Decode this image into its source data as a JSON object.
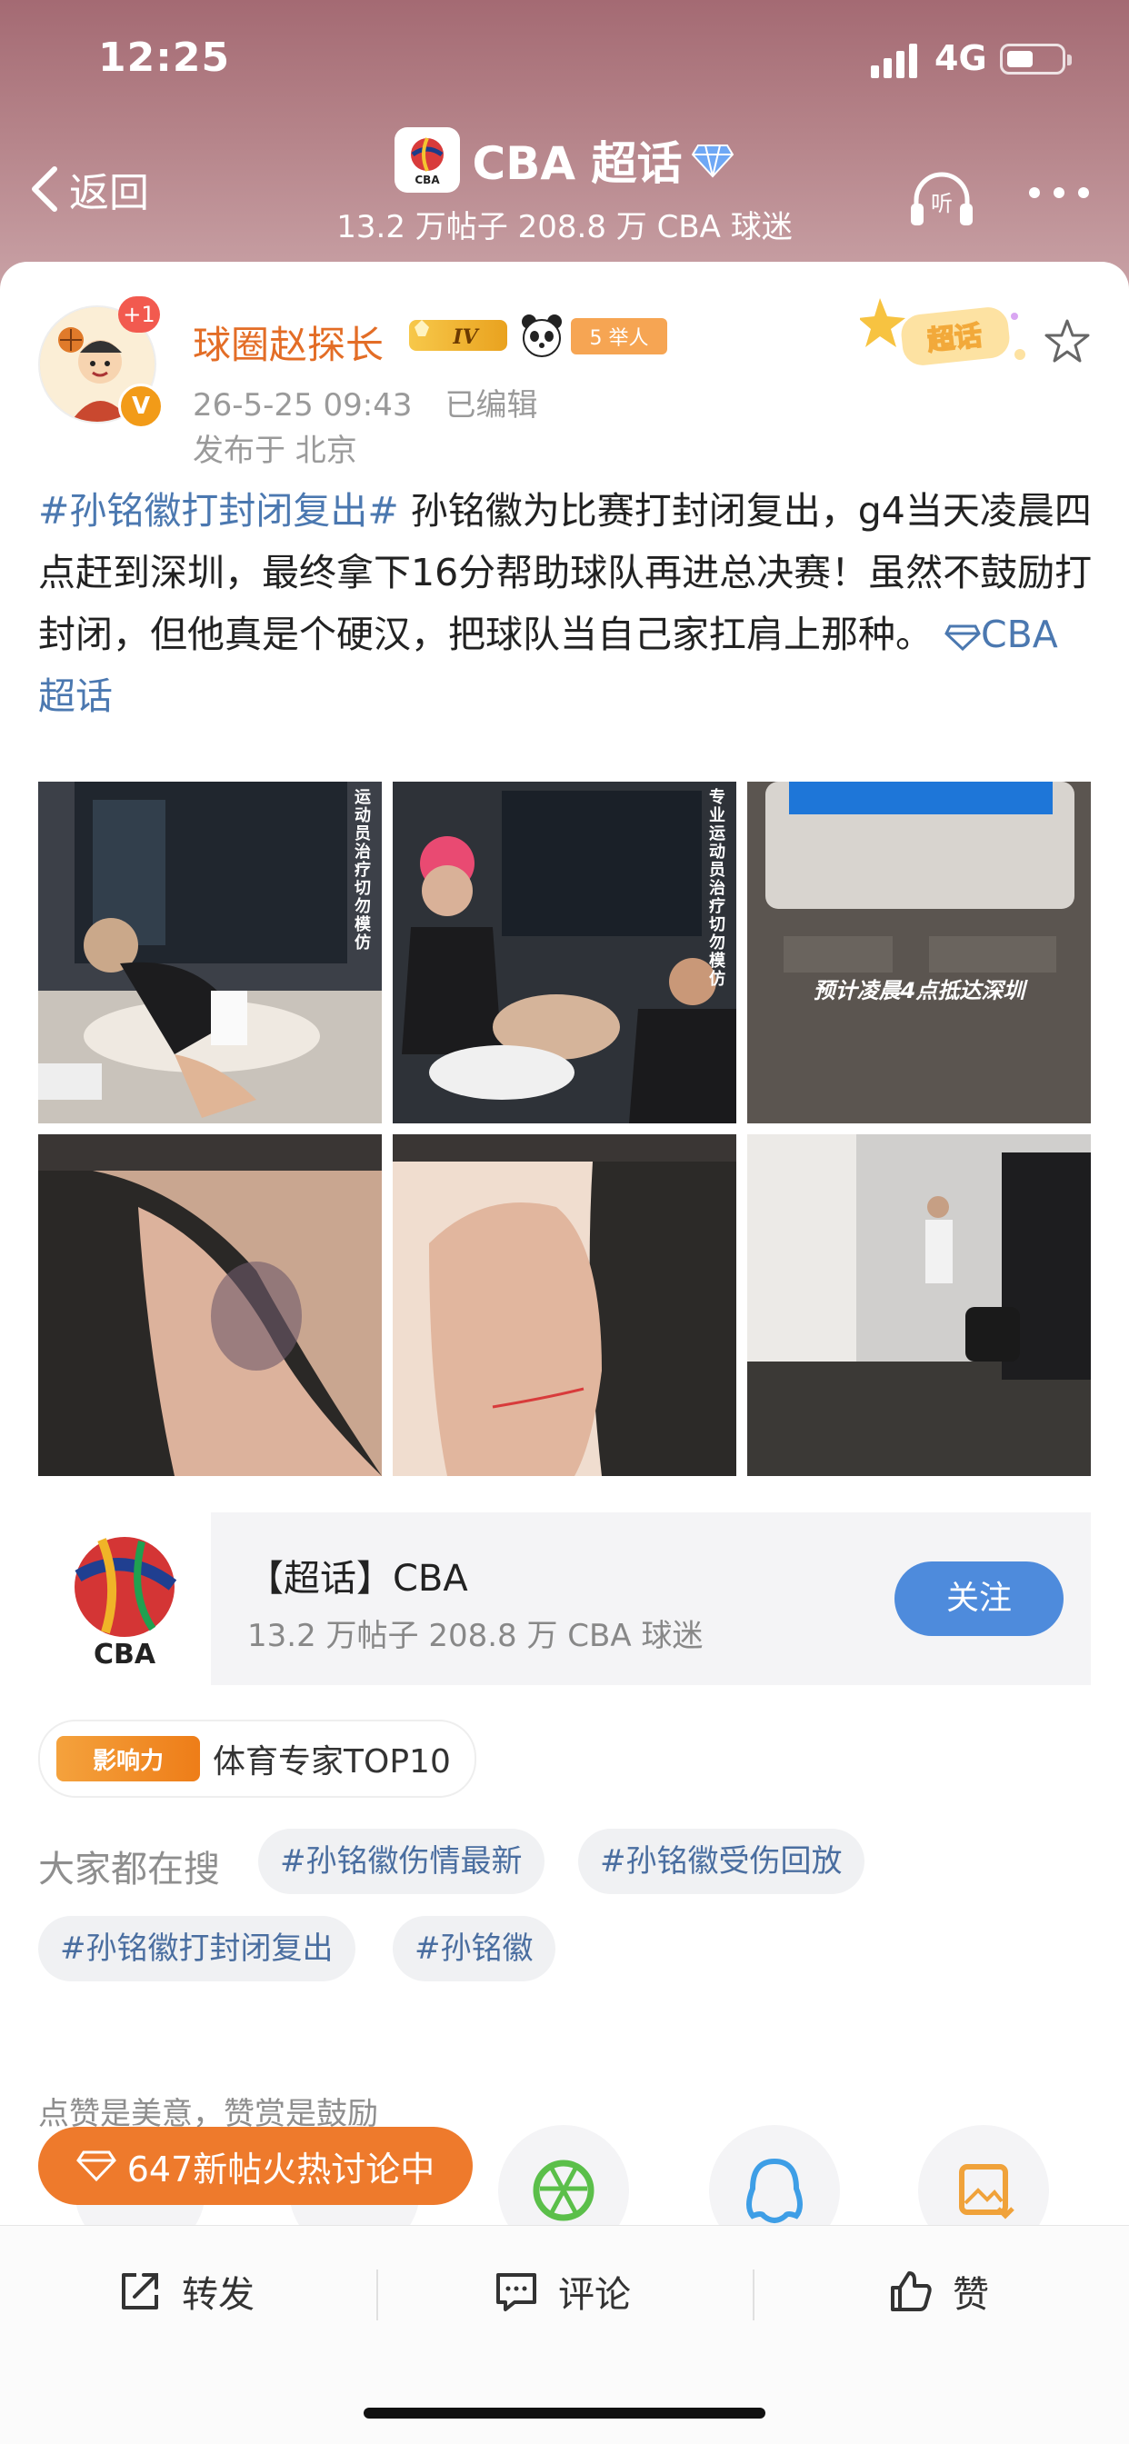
{
  "status_bar": {
    "time": "12:25",
    "network": "4G"
  },
  "nav": {
    "back_label": "返回",
    "title": "CBA 超话",
    "subtitle": "13.2 万帖子 208.8 万 CBA 球迷",
    "listen_label": "听",
    "logo_text": "CBA"
  },
  "post": {
    "username": "球圈赵探长",
    "plus_badge": "+1",
    "verified_badge": "V",
    "level_badge": "IV",
    "points_badge": "5 举人",
    "timestamp": "26-5-25 09:43",
    "edited": "已编辑",
    "location": "发布于 北京",
    "sticker_text": "超话",
    "text": {
      "hashtag": "#孙铭徽打封闭复出#",
      "body": " 孙铭徽为比赛打封闭复出，g4当天凌晨四点赶到深圳，最终拿下16分帮助球队再进总决赛！虽然不鼓励打封闭，但他真是个硬汉，把球队当自己家扛肩上那种。",
      "topic_link": "CBA 超话"
    },
    "photos": [
      {
        "overlay_vertical": "运动员治疗 切勿模仿"
      },
      {
        "overlay_vertical": "专业运动员治疗 切勿模仿"
      },
      {
        "overlay_caption": "预计凌晨4点抵达深圳"
      },
      {
        "overlay_caption": ""
      },
      {
        "overlay_caption": ""
      },
      {
        "overlay_caption": ""
      }
    ]
  },
  "topic_card": {
    "title": "【超话】CBA",
    "subtitle": "13.2 万帖子 208.8 万 CBA 球迷",
    "follow_label": "关注",
    "logo_text": "CBA"
  },
  "influence": {
    "badge": "影响力",
    "label": "体育专家TOP10"
  },
  "search": {
    "label": "大家都在搜",
    "chips": [
      "#孙铭徽伤情最新",
      "#孙铭徽受伤回放",
      "#孙铭徽打封闭复出",
      "#孙铭徽"
    ]
  },
  "reward": {
    "text": "点赞是美意，赞赏是鼓励"
  },
  "hot_pill": {
    "label": "647新帖火热讨论中"
  },
  "actions": {
    "repost": "转发",
    "comment": "评论",
    "like": "赞"
  },
  "colors": {
    "username": "#e36d26",
    "hashtag": "#4b78b0",
    "follow_button": "#4e8bdc",
    "hot_pill": "#ee7a2c"
  }
}
